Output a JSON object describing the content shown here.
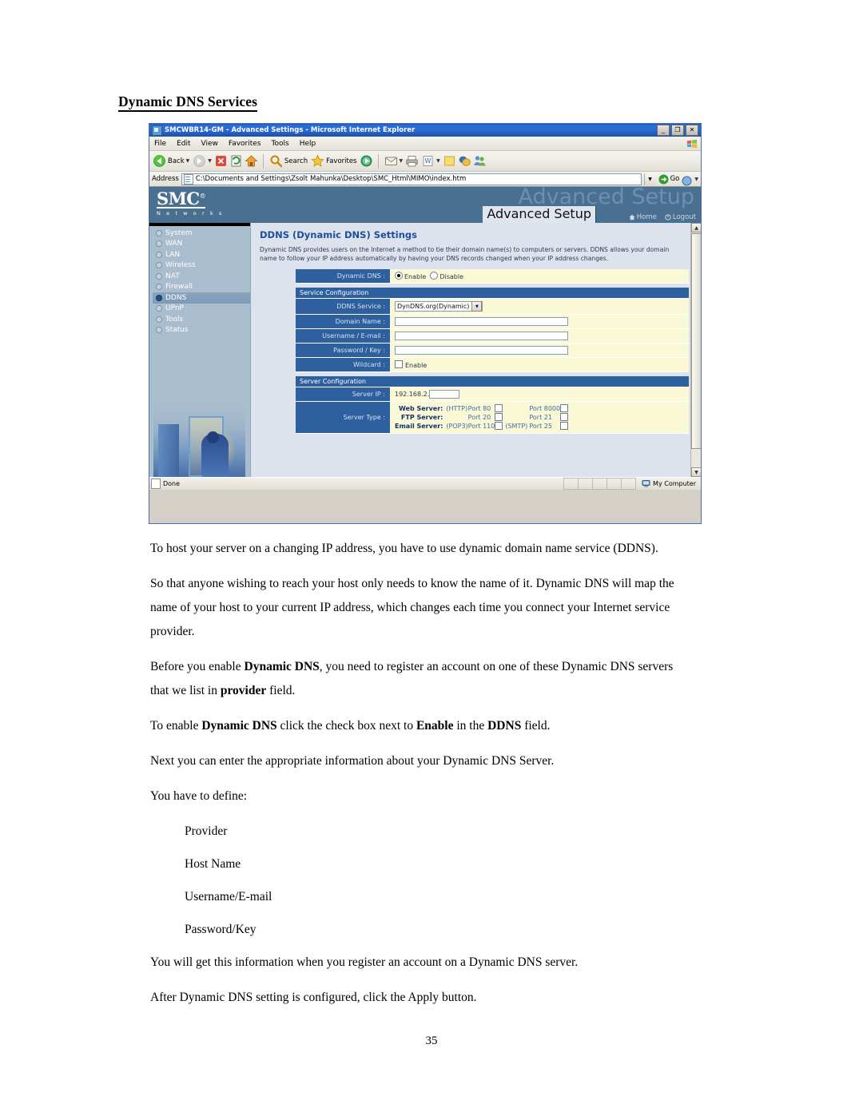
{
  "document": {
    "heading": "Dynamic DNS Services",
    "page_number": "35",
    "paragraphs": [
      {
        "id": "p1",
        "runs": [
          {
            "t": "To host your server on a changing IP address, you have to use dynamic domain name service (DDNS)."
          }
        ]
      },
      {
        "id": "p2",
        "runs": [
          {
            "t": "So that anyone wishing to reach your host only needs to know the name of it. Dynamic DNS will map the name of your host to your current IP address, which changes each time you connect your Internet service provider."
          }
        ]
      },
      {
        "id": "p3",
        "runs": [
          {
            "t": "Before you enable "
          },
          {
            "t": "Dynamic DNS",
            "b": true
          },
          {
            "t": ", you need to register an account on one of these Dynamic DNS servers that we list in "
          },
          {
            "t": "provider",
            "b": true
          },
          {
            "t": " field."
          }
        ]
      },
      {
        "id": "p4",
        "runs": [
          {
            "t": "To enable "
          },
          {
            "t": "Dynamic DNS",
            "b": true
          },
          {
            "t": " click the check box next to "
          },
          {
            "t": "Enable",
            "b": true
          },
          {
            "t": " in the "
          },
          {
            "t": "DDNS",
            "b": true
          },
          {
            "t": " field."
          }
        ]
      },
      {
        "id": "p5",
        "runs": [
          {
            "t": "Next you can enter the appropriate information about your Dynamic DNS Server."
          }
        ]
      },
      {
        "id": "p6",
        "runs": [
          {
            "t": "You have to define:"
          }
        ]
      },
      {
        "id": "p7",
        "indent": true,
        "runs": [
          {
            "t": "Provider"
          }
        ]
      },
      {
        "id": "p8",
        "indent": true,
        "runs": [
          {
            "t": "Host Name"
          }
        ]
      },
      {
        "id": "p9",
        "indent": true,
        "runs": [
          {
            "t": "Username/E-mail"
          }
        ]
      },
      {
        "id": "p10",
        "indent": true,
        "runs": [
          {
            "t": "Password/Key"
          }
        ]
      },
      {
        "id": "p11",
        "runs": [
          {
            "t": "You will get this information when you register an account on a Dynamic DNS server."
          }
        ]
      },
      {
        "id": "p12",
        "runs": [
          {
            "t": "After Dynamic DNS setting is configured, click the Apply button."
          }
        ]
      }
    ]
  },
  "browser": {
    "title": "SMCWBR14-GM - Advanced Settings - Microsoft Internet Explorer",
    "window_buttons": {
      "minimize": "_",
      "restore": "❐",
      "close": "✕"
    },
    "menu": [
      {
        "label": "File",
        "accel": "F"
      },
      {
        "label": "Edit",
        "accel": "E"
      },
      {
        "label": "View",
        "accel": "V"
      },
      {
        "label": "Favorites",
        "accel": "a"
      },
      {
        "label": "Tools",
        "accel": "T"
      },
      {
        "label": "Help",
        "accel": "H"
      }
    ],
    "toolbar": [
      {
        "name": "back-button",
        "label": "Back",
        "has_dropdown": true
      },
      {
        "name": "forward-button",
        "label": "",
        "has_dropdown": true
      },
      {
        "name": "stop-button",
        "label": ""
      },
      {
        "name": "refresh-button",
        "label": ""
      },
      {
        "name": "home-button",
        "label": ""
      },
      {
        "name": "search-button",
        "label": "Search"
      },
      {
        "name": "favorites-button",
        "label": "Favorites"
      },
      {
        "name": "media-button",
        "label": ""
      },
      {
        "name": "mail-button",
        "label": "",
        "has_dropdown": true
      },
      {
        "name": "print-button",
        "label": ""
      },
      {
        "name": "edit-word-button",
        "label": "",
        "has_dropdown": true
      },
      {
        "name": "notes-button",
        "label": ""
      },
      {
        "name": "messenger-button",
        "label": ""
      },
      {
        "name": "realplayer-button",
        "label": ""
      }
    ],
    "address": {
      "label": "Address",
      "url": "C:\\Documents and Settings\\Zsolt Mahunka\\Desktop\\SMC_Html\\MIMO\\index.htm",
      "go_label": "Go"
    },
    "statusbar": {
      "status": "Done",
      "zone": "My Computer",
      "cell_count": 5
    }
  },
  "router": {
    "brand": {
      "name": "SMC",
      "registered": "®",
      "tagline": "N e t w o r k s"
    },
    "header": {
      "watermark": "Advanced Setup",
      "tab_label": "Advanced Setup",
      "links": [
        {
          "name": "home-link",
          "label": "Home",
          "icon": "home-icon"
        },
        {
          "name": "logout-link",
          "label": "Logout",
          "icon": "power-icon"
        }
      ]
    },
    "sidebar": {
      "items": [
        {
          "label": "System",
          "selected": false
        },
        {
          "label": "WAN",
          "selected": false
        },
        {
          "label": "LAN",
          "selected": false
        },
        {
          "label": "Wireless",
          "selected": false
        },
        {
          "label": "NAT",
          "selected": false
        },
        {
          "label": "Firewall",
          "selected": false
        },
        {
          "label": "DDNS",
          "selected": true
        },
        {
          "label": "UPnP",
          "selected": false
        },
        {
          "label": "Tools",
          "selected": false
        },
        {
          "label": "Status",
          "selected": false
        }
      ]
    },
    "page": {
      "title": "DDNS (Dynamic DNS) Settings",
      "description": "Dynamic DNS provides users on the Internet a method to tie their domain name(s) to computers or servers. DDNS allows your domain name to follow your IP address automatically by having your DNS records changed when your IP address changes.",
      "dynamic_dns": {
        "label": "Dynamic DNS :",
        "options": [
          {
            "label": "Enable",
            "selected": true
          },
          {
            "label": "Disable",
            "selected": false
          }
        ]
      },
      "service_configuration": {
        "section_title": "Service Configuration",
        "ddns_service": {
          "label": "DDNS Service :",
          "value": "DynDNS.org(Dynamic)"
        },
        "domain_name": {
          "label": "Domain Name :",
          "value": ""
        },
        "username_email": {
          "label": "Username / E-mail :",
          "value": ""
        },
        "password_key": {
          "label": "Password / Key :",
          "value": ""
        },
        "wildcard": {
          "label": "Wildcard :",
          "checkbox_label": "Enable",
          "checked": false
        }
      },
      "server_configuration": {
        "section_title": "Server Configuration",
        "server_ip": {
          "label": "Server IP :",
          "prefix": "192.168.2.",
          "value": ""
        },
        "server_type": {
          "label": "Server Type :",
          "rows": [
            {
              "name": "Web Server:",
              "left_proto": "(HTTP)",
              "left_port": "Port 80",
              "left_checked": false,
              "right_proto": "",
              "right_port": "Port 8000",
              "right_checked": false
            },
            {
              "name": "FTP Server:",
              "left_proto": "",
              "left_port": "Port 20",
              "left_checked": false,
              "right_proto": "",
              "right_port": "Port 21",
              "right_checked": false
            },
            {
              "name": "Email Server:",
              "left_proto": "(POP3)",
              "left_port": "Port 110",
              "left_checked": false,
              "right_proto": "(SMTP)",
              "right_port": "Port 25",
              "right_checked": false
            }
          ]
        }
      }
    }
  },
  "colors": {
    "heading": "#000000",
    "router_header_bg": "#496f91",
    "sidebar_bg": "#a9bdcf",
    "content_bg": "#dde3ec",
    "section_blue": "#2e5f9e",
    "field_yellow": "#fbf8d6",
    "title_blue": "#1f4e9c",
    "titlebar_blue": "#2a68d0"
  }
}
